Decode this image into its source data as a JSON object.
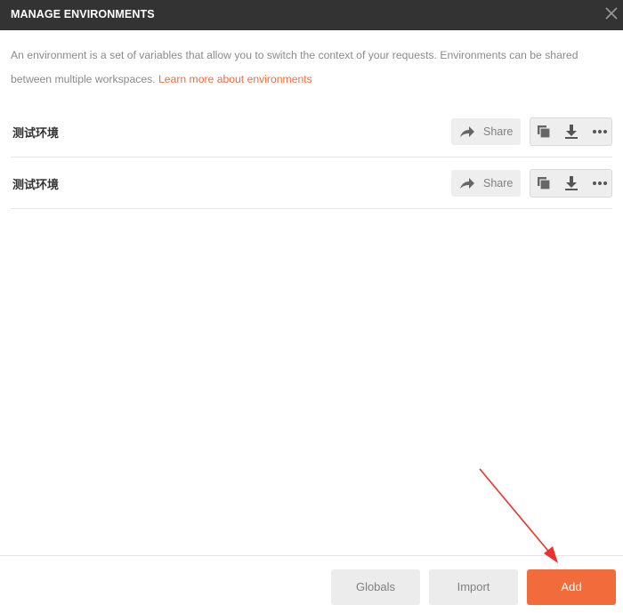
{
  "dialog": {
    "title": "MANAGE ENVIRONMENTS",
    "description": "An environment is a set of variables that allow you to switch the context of your requests. Environments can be shared between multiple workspaces.",
    "learn_more_link": "Learn more about environments"
  },
  "environments": [
    {
      "name": "测试环境",
      "share_label": "Share"
    },
    {
      "name": "测试环境",
      "share_label": "Share"
    }
  ],
  "icons": {
    "close": "close-icon",
    "share": "share-arrow-icon",
    "duplicate": "duplicate-icon",
    "download": "download-icon",
    "more": "more-icon"
  },
  "footer": {
    "globals_label": "Globals",
    "import_label": "Import",
    "add_label": "Add"
  },
  "colors": {
    "titlebar": "#333333",
    "accent": "#f26b3a",
    "annotation_arrow": "#e8322e"
  }
}
